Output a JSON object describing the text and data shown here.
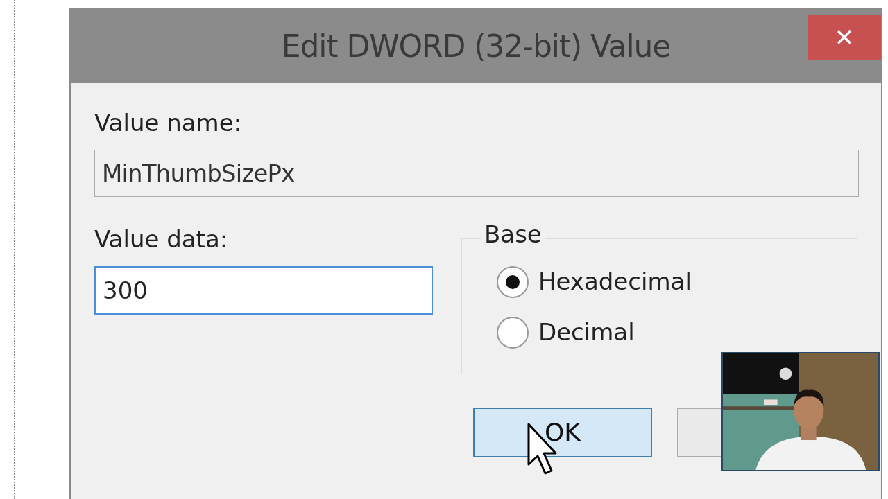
{
  "window": {
    "title": "Edit DWORD (32-bit) Value",
    "close": "✕"
  },
  "value_name": {
    "label": "Value name:",
    "value": "MinThumbSizePx"
  },
  "value_data": {
    "label": "Value data:",
    "value": "300"
  },
  "base": {
    "label": "Base",
    "options": [
      {
        "label": "Hexadecimal",
        "selected": true
      },
      {
        "label": "Decimal",
        "selected": false
      }
    ]
  },
  "buttons": [
    {
      "label": "OK",
      "focused": true
    },
    {
      "focused": false
    }
  ]
}
